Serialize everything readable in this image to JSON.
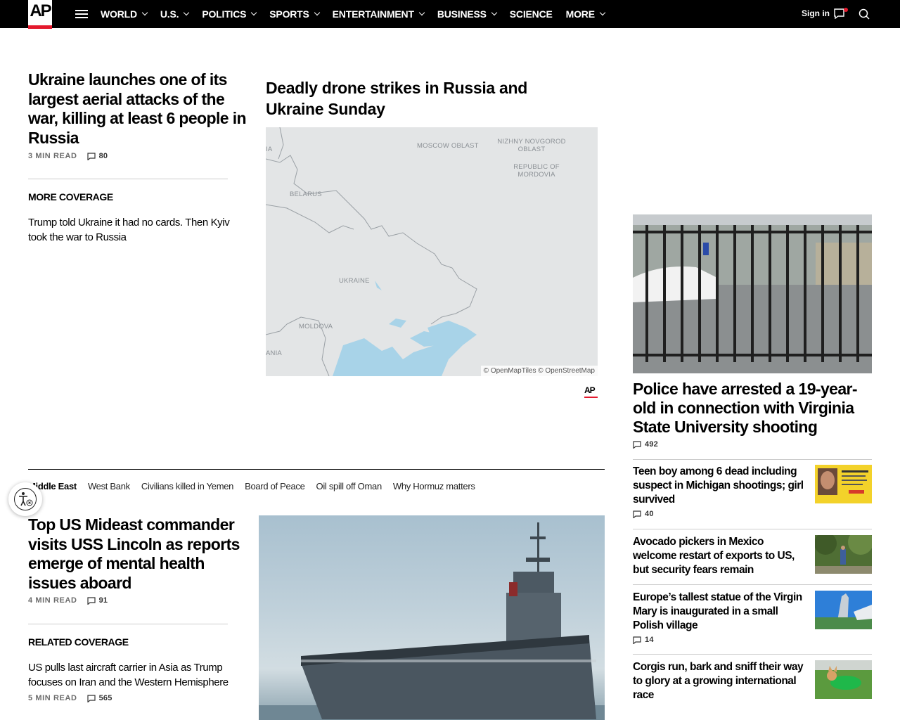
{
  "nav": {
    "logo": "AP",
    "items": [
      {
        "label": "WORLD",
        "dropdown": true
      },
      {
        "label": "U.S.",
        "dropdown": true
      },
      {
        "label": "POLITICS",
        "dropdown": true
      },
      {
        "label": "SPORTS",
        "dropdown": true
      },
      {
        "label": "ENTERTAINMENT",
        "dropdown": true
      },
      {
        "label": "BUSINESS",
        "dropdown": true
      },
      {
        "label": "SCIENCE",
        "dropdown": false
      },
      {
        "label": "MORE",
        "dropdown": true
      }
    ],
    "signin": "Sign in",
    "icons": [
      "menu-icon",
      "chat-icon",
      "search-icon"
    ],
    "accent": "#e4192d"
  },
  "lead": {
    "title": "Ukraine launches one of its largest aerial attacks of the war, killing at least 6 people in Russia",
    "read_time": "3 MIN READ",
    "comments": "80",
    "coverage_label": "MORE COVERAGE",
    "coverage_link": "Trump told Ukraine it had no cards. Then Kyiv took the war to Russia"
  },
  "map": {
    "title": "Deadly drone strikes in Russia and Ukraine Sunday",
    "labels": {
      "moscow": "MOSCOW OBLAST",
      "nizhny": "NIZHNY NOVGOROD OBLAST",
      "mordovia": "REPUBLIC OF MORDOVIA",
      "belarus": "BELARUS",
      "ukraine": "UKRAINE",
      "moldova": "MOLDOVA",
      "edge_top": "IA",
      "edge_bottom": "ANIA"
    },
    "attribution": "© OpenMapTiles © OpenStreetMap",
    "credit": "AP"
  },
  "tags": [
    "Middle East",
    "West Bank",
    "Civilians killed in Yemen",
    "Board of Peace",
    "Oil spill off Oman",
    "Why Hormuz matters"
  ],
  "story2": {
    "title": "Top US Mideast commander visits USS Lincoln as reports emerge of mental health issues aboard",
    "read_time": "4 MIN READ",
    "comments": "91",
    "coverage_label": "RELATED COVERAGE",
    "coverage_link": "US pulls last aircraft carrier in Asia as Trump focuses on Iran and the Western Hemisphere",
    "coverage_read_time": "5 MIN READ",
    "coverage_comments": "565"
  },
  "rail": {
    "top": {
      "title": "Police have arrested a 19-year-old in connection with Virginia State University shooting",
      "comments": "492"
    },
    "items": [
      {
        "title": "Teen boy among 6 dead including suspect in Michigan shootings; girl survived",
        "comments": "40"
      },
      {
        "title": "Avocado pickers in Mexico welcome restart of exports to US, but security fears remain",
        "comments": ""
      },
      {
        "title": "Europe’s tallest statue of the Virgin Mary is inaugurated in a small Polish village",
        "comments": "14"
      },
      {
        "title": "Corgis run, bark and sniff their way to glory at a growing international race",
        "comments": ""
      }
    ]
  }
}
